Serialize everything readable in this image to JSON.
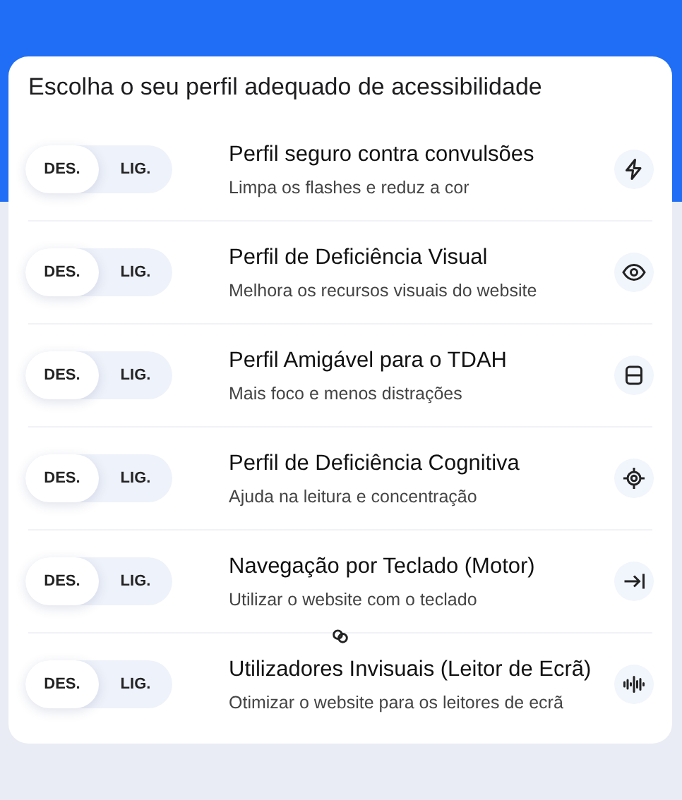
{
  "title": "Escolha o seu perfil adequado de acessibilidade",
  "profiles": [
    {
      "off_label": "DES.",
      "on_label": "LIG.",
      "on": false,
      "title": "Perfil seguro contra convulsões",
      "description": "Limpa os flashes e reduz a cor"
    },
    {
      "off_label": "DES.",
      "on_label": "LIG.",
      "on": false,
      "title": "Perfil de Deficiência Visual",
      "description": "Melhora os recursos visuais do website"
    },
    {
      "off_label": "DES.",
      "on_label": "LIG.",
      "on": false,
      "title": "Perfil Amigável para o TDAH",
      "description": "Mais foco e menos distrações"
    },
    {
      "off_label": "DES.",
      "on_label": "LIG.",
      "on": false,
      "title": "Perfil de Deficiência Cognitiva",
      "description": "Ajuda na leitura e concentração"
    },
    {
      "off_label": "DES.",
      "on_label": "LIG.",
      "on": false,
      "title": "Navegação por Teclado (Motor)",
      "description": "Utilizar o website com o teclado"
    },
    {
      "off_label": "DES.",
      "on_label": "LIG.",
      "on": false,
      "title": "Utilizadores Invisuais (Leitor de Ecrã)",
      "description": "Otimizar o website para os leitores de ecrã"
    }
  ]
}
